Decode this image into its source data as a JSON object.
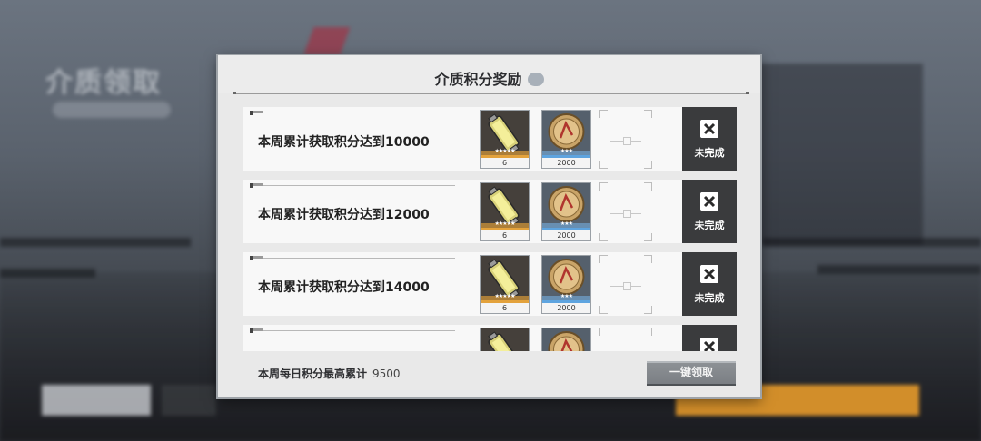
{
  "background": {
    "title": "介质领取"
  },
  "modal": {
    "title": "介质积分奖励",
    "info_icon": "info-icon",
    "rows": [
      {
        "task": "本周累计获取积分达到10000",
        "items": [
          {
            "icon": "battery-icon",
            "qty": "6",
            "stars": "★★★★★"
          },
          {
            "icon": "coin-icon",
            "qty": "2000",
            "stars": "★★★"
          }
        ],
        "status": "未完成"
      },
      {
        "task": "本周累计获取积分达到12000",
        "items": [
          {
            "icon": "battery-icon",
            "qty": "6",
            "stars": "★★★★★"
          },
          {
            "icon": "coin-icon",
            "qty": "2000",
            "stars": "★★★"
          }
        ],
        "status": "未完成"
      },
      {
        "task": "本周累计获取积分达到14000",
        "items": [
          {
            "icon": "battery-icon",
            "qty": "6",
            "stars": "★★★★★"
          },
          {
            "icon": "coin-icon",
            "qty": "2000",
            "stars": "★★★"
          }
        ],
        "status": "未完成"
      },
      {
        "task": "",
        "items": [
          {
            "icon": "battery-icon",
            "qty": "",
            "stars": ""
          },
          {
            "icon": "coin-icon",
            "qty": "",
            "stars": ""
          }
        ],
        "status": ""
      }
    ],
    "footer": {
      "label": "本周每日积分最高累计",
      "value": "9500",
      "claim_all": "一键领取"
    }
  },
  "colors": {
    "accent_orange": "#e59a2b",
    "rarity_gold": "#e3a23c",
    "rarity_blue": "#5ea4df",
    "status_bg": "#3a3b3d"
  }
}
